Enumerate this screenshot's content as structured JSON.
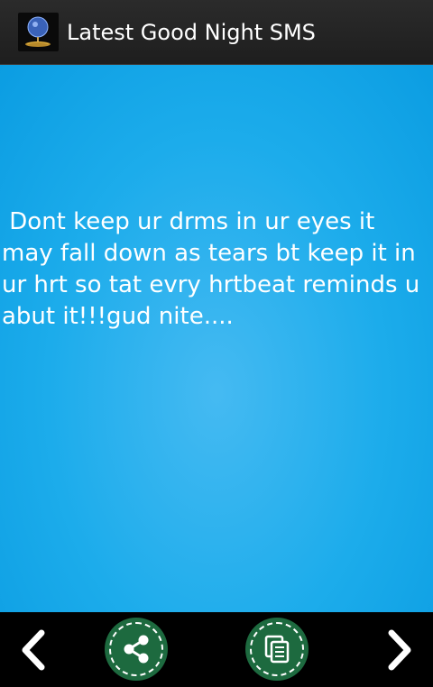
{
  "app": {
    "title": "Latest Good Night SMS",
    "icon": "moon-globe-app-icon"
  },
  "message": {
    "text": " Dont keep ur drms in ur eyes it\nmay fall down as tears bt keep it in\nur hrt so tat evry hrtbeat reminds u\nabut it!!!gud nite...."
  },
  "bottom_bar": {
    "prev_icon": "chevron-left-icon",
    "share_icon": "share-icon",
    "copy_icon": "copy-icon",
    "next_icon": "chevron-right-icon"
  },
  "colors": {
    "action_bar": "#222222",
    "content_bg": "#1caceb",
    "button_green": "#1d6a3f",
    "text": "#ffffff"
  }
}
